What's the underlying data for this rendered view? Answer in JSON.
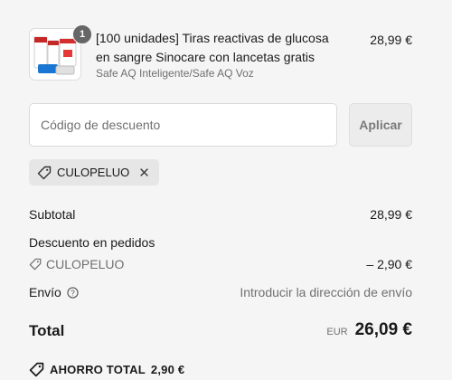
{
  "product": {
    "quantity": "1",
    "title": "[100 unidades] Tiras reactivas de glucosa en sangre Sinocare con lancetas gratis",
    "variant": "Safe AQ Inteligente/Safe AQ Voz",
    "price": "28,99 €"
  },
  "discount": {
    "placeholder": "Código de descuento",
    "apply_label": "Aplicar",
    "applied_code": "CULOPELUO"
  },
  "summary": {
    "subtotal_label": "Subtotal",
    "subtotal_value": "28,99 €",
    "order_discount_label": "Descuento en pedidos",
    "order_discount_code": "CULOPELUO",
    "order_discount_value": "– 2,90 €",
    "shipping_label": "Envío",
    "shipping_value": "Introducir la dirección de envío",
    "total_label": "Total",
    "currency": "EUR",
    "total_value": "26,09 €",
    "savings_label": "AHORRO TOTAL",
    "savings_value": "2,90 €"
  },
  "colors": {
    "background": "#f5f5f5",
    "badge": "#666666",
    "chip": "#e6e6e6",
    "muted_text": "#707070"
  }
}
